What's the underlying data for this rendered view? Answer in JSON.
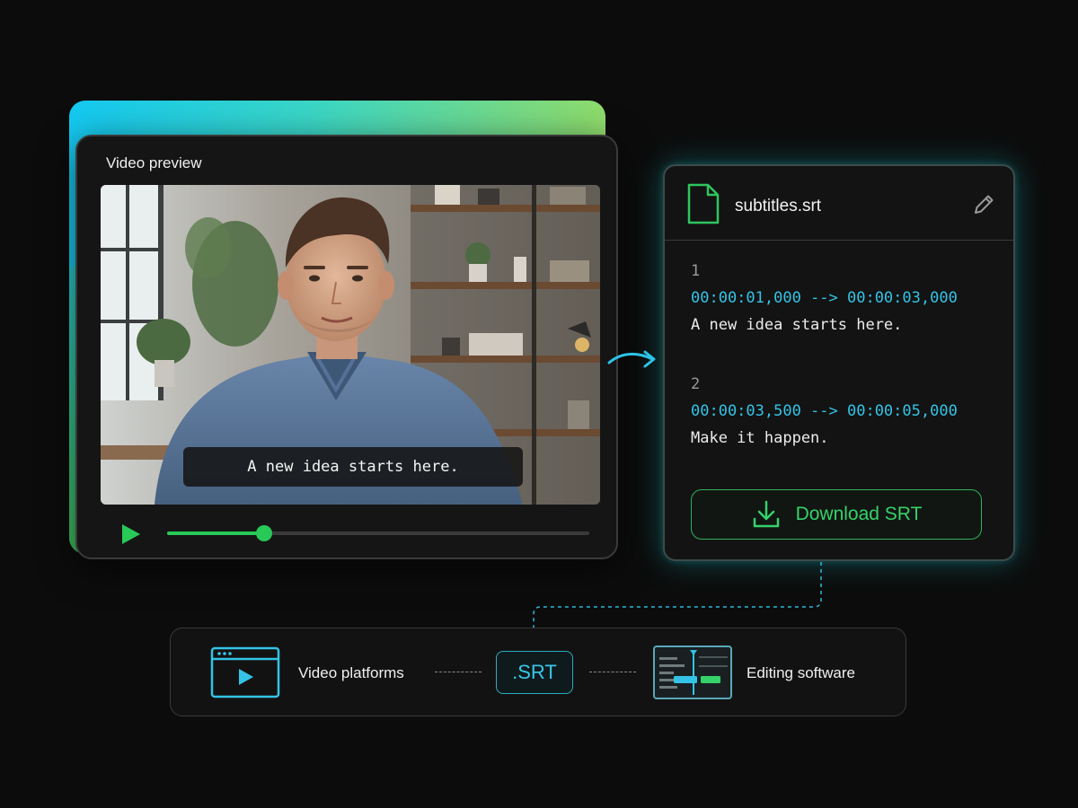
{
  "video_panel": {
    "title": "Video preview",
    "subtitle_overlay": "A new idea starts here.",
    "playback_progress": 0.23
  },
  "srt_panel": {
    "file_name": "subtitles.srt",
    "cues": [
      {
        "index": "1",
        "timing": "00:00:01,000 --> 00:00:03,000",
        "text": "A new idea starts here."
      },
      {
        "index": "2",
        "timing": "00:00:03,500 --> 00:00:05,000",
        "text": "Make it happen."
      }
    ],
    "download_label": "Download SRT"
  },
  "bottom_bar": {
    "left_label": "Video platforms",
    "center_chip": ".SRT",
    "right_label": "Editing software"
  },
  "colors": {
    "accent_green": "#28c957",
    "accent_cyan": "#34c3e6",
    "background": "#0c0c0c"
  },
  "icons": [
    "file-icon",
    "edit-icon",
    "play-icon",
    "download-icon",
    "browser-video-icon",
    "timeline-editor-icon",
    "flow-arrow-icon"
  ]
}
